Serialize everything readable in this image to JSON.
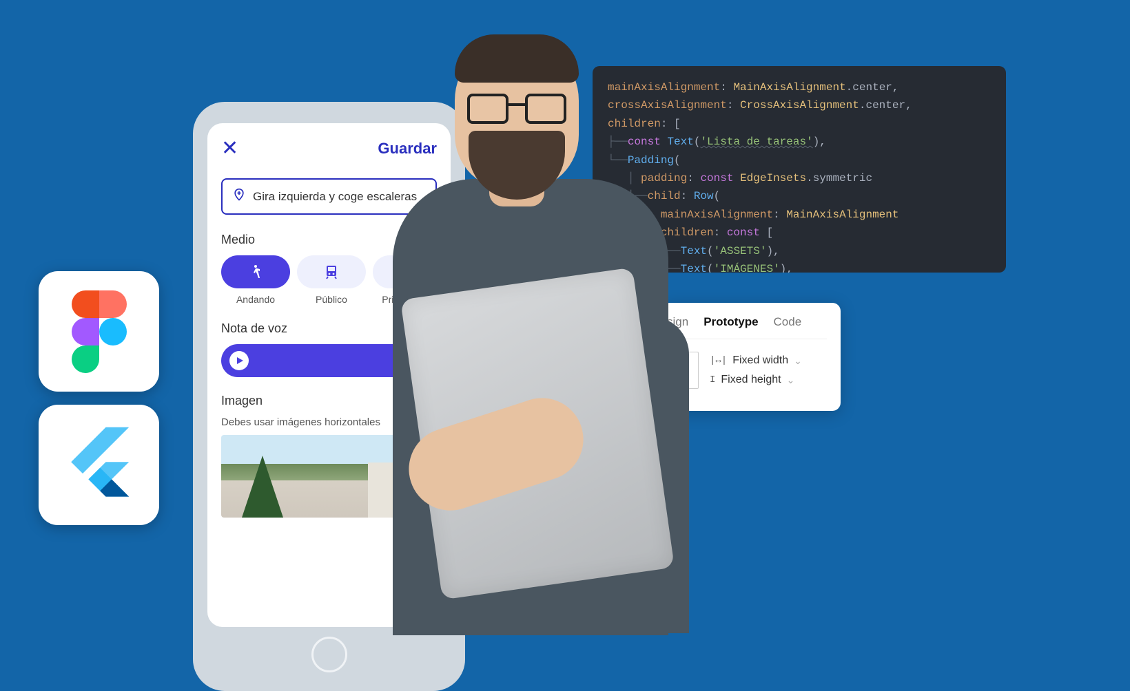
{
  "apps": {
    "figma": "Figma",
    "flutter": "Flutter"
  },
  "phone": {
    "close_label": "✕",
    "save_label": "Guardar",
    "input_value": "Gira izquierda y coge escaleras",
    "medio_label": "Medio",
    "chips": {
      "walking": "Andando",
      "public": "Público",
      "private": "Privado"
    },
    "voice_label": "Nota de voz",
    "image_label": "Imagen",
    "image_hint": "Debes usar imágenes horizontales"
  },
  "code": {
    "l1_prop": "mainAxisAlignment",
    "l1_type": "MainAxisAlignment",
    "l1_member": "center",
    "l2_prop": "crossAxisAlignment",
    "l2_type": "CrossAxisAlignment",
    "l2_member": "center",
    "l3_prop": "children",
    "l4_const": "const",
    "l4_class": "Text",
    "l4_str": "'Lista de tareas'",
    "l5_class": "Padding",
    "l6_prop": "padding",
    "l6_const": "const",
    "l6_type": "EdgeInsets",
    "l6_member": "symmetric",
    "l7_prop": "child",
    "l7_class": "Row",
    "l8_prop": "mainAxisAlignment",
    "l8_type": "MainAxisAlignment",
    "l9_prop": "children",
    "l9_const": "const",
    "l10_class": "Text",
    "l10_str": "'ASSETS'",
    "l11_class": "Text",
    "l11_str": "'IMÁGENES'"
  },
  "inspector": {
    "tab_design": "sign",
    "tab_prototype": "Prototype",
    "tab_code": "Code",
    "fixed_width": "Fixed width",
    "fixed_height": "Fixed height"
  }
}
